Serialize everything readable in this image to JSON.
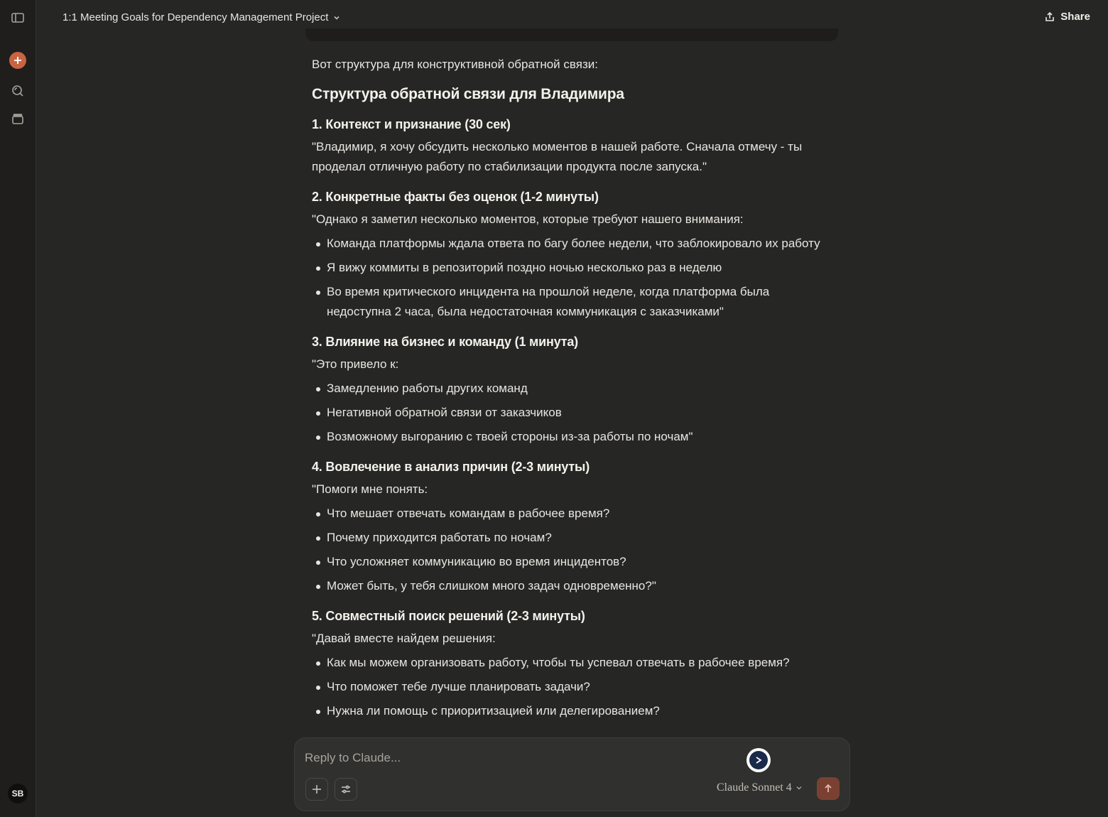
{
  "header": {
    "title": "1:1 Meeting Goals for Dependency Management Project",
    "share_label": "Share"
  },
  "sidebar": {
    "avatar_initials": "SB"
  },
  "message": {
    "intro": "Вот структура для конструктивной обратной связи:",
    "heading": "Структура обратной связи для Владимира",
    "sections": [
      {
        "title": "1. Контекст и признание (30 сек)",
        "text": "\"Владимир, я хочу обсудить несколько моментов в нашей работе. Сначала отмечу - ты проделал отличную работу по стабилизации продукта после запуска.\"",
        "items": []
      },
      {
        "title": "2. Конкретные факты без оценок (1-2 минуты)",
        "text": "\"Однако я заметил несколько моментов, которые требуют нашего внимания:",
        "items": [
          "Команда платформы ждала ответа по багу более недели, что заблокировало их работу",
          "Я вижу коммиты в репозиторий поздно ночью несколько раз в неделю",
          "Во время критического инцидента на прошлой неделе, когда платформа была недоступна 2 часа, была недостаточная коммуникация с заказчиками\""
        ]
      },
      {
        "title": "3. Влияние на бизнес и команду (1 минута)",
        "text": "\"Это привело к:",
        "items": [
          "Замедлению работы других команд",
          "Негативной обратной связи от заказчиков",
          "Возможному выгоранию с твоей стороны из-за работы по ночам\""
        ]
      },
      {
        "title": "4. Вовлечение в анализ причин (2-3 минуты)",
        "text": "\"Помоги мне понять:",
        "items": [
          "Что мешает отвечать командам в рабочее время?",
          "Почему приходится работать по ночам?",
          "Что усложняет коммуникацию во время инцидентов?",
          "Может быть, у тебя слишком много задач одновременно?\""
        ]
      },
      {
        "title": "5. Совместный поиск решений (2-3 минуты)",
        "text": "\"Давай вместе найдем решения:",
        "items": [
          "Как мы можем организовать работу, чтобы ты успевал отвечать в рабочее время?",
          "Что поможет тебе лучше планировать задачи?",
          "Нужна ли помощь с приоритизацией или делегированием?"
        ]
      }
    ]
  },
  "composer": {
    "placeholder": "Reply to Claude...",
    "model_label": "Claude Sonnet 4"
  },
  "colors": {
    "background": "#262624",
    "accent": "#c96442",
    "send_button": "#7a4132"
  },
  "icons": [
    "sidebar-toggle-icon",
    "plus-icon",
    "search-chat-icon",
    "archive-icon",
    "chevron-down-icon",
    "share-icon",
    "tools-sliders-icon",
    "arrow-up-icon",
    "extension-icon"
  ]
}
